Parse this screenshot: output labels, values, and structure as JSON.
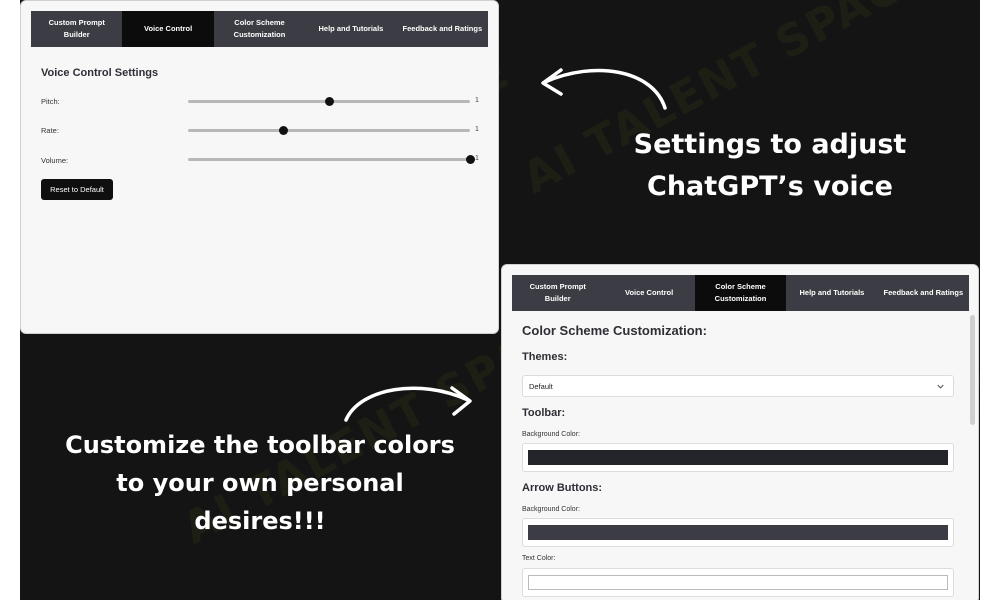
{
  "tabs": [
    {
      "label": "Custom Prompt Builder"
    },
    {
      "label": "Voice Control"
    },
    {
      "label": "Color Scheme Customization"
    },
    {
      "label": "Help and Tutorials"
    },
    {
      "label": "Feedback and Ratings"
    }
  ],
  "panel1": {
    "active_tab": 1,
    "title": "Voice Control Settings",
    "sliders": [
      {
        "label": "Pitch:",
        "value_text": "1",
        "fraction": 0.5
      },
      {
        "label": "Rate:",
        "value_text": "1",
        "fraction": 0.34
      },
      {
        "label": "Volume:",
        "value_text": "1",
        "fraction": 1.0
      }
    ],
    "reset_label": "Reset to Default"
  },
  "panel2": {
    "active_tab": 2,
    "title": "Color Scheme Customization:",
    "themes_heading": "Themes:",
    "theme_selected": "Default",
    "toolbar_heading": "Toolbar:",
    "toolbar_bg_label": "Background Color:",
    "toolbar_bg_color": "#24252b",
    "arrow_heading": "Arrow Buttons:",
    "arrow_bg_label": "Background Color:",
    "arrow_bg_color": "#3c3d44",
    "arrow_text_label": "Text Color:",
    "arrow_text_color": "#ffffff"
  },
  "captions": {
    "voice": "Settings to adjust ChatGPT’s voice",
    "toolbar": "Customize the toolbar colors to your own personal desires!!!"
  },
  "watermark_text": "AI TALENT SPACE",
  "icons": {
    "chevron": "chevron-down-icon",
    "arrow": "curved-arrow-icon",
    "logo": "brain-logo-icon"
  }
}
